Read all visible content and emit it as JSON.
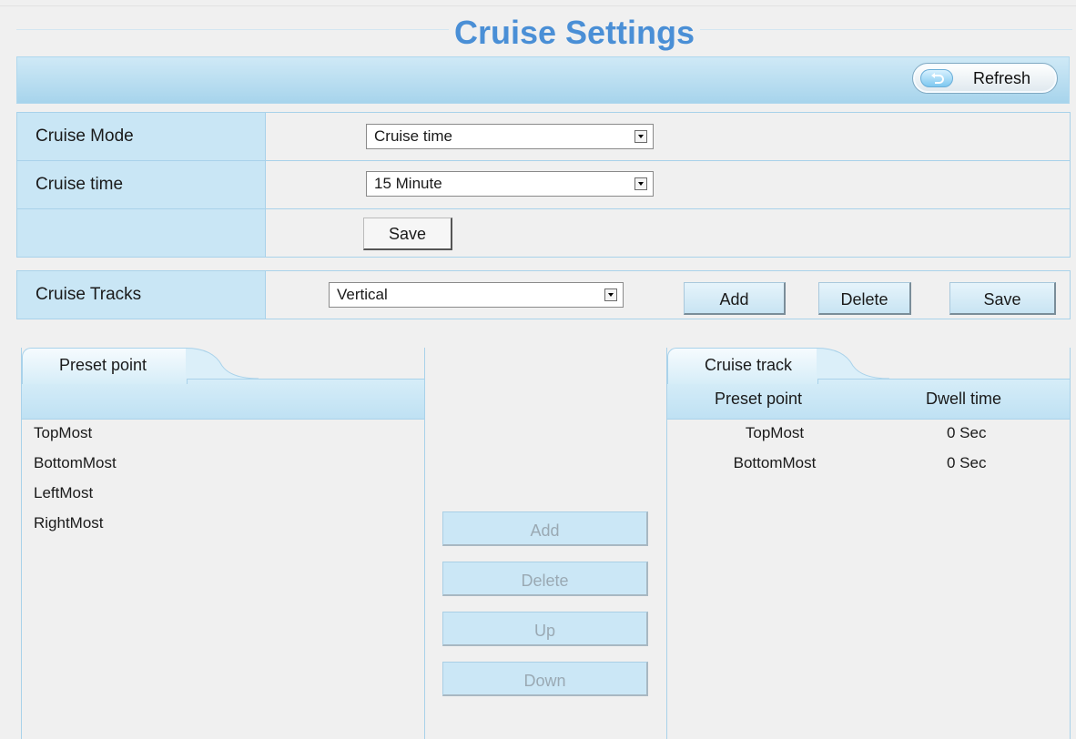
{
  "title": "Cruise Settings",
  "header": {
    "refresh_label": "Refresh"
  },
  "cruise_form": {
    "mode_label": "Cruise Mode",
    "mode_value": "Cruise time",
    "time_label": "Cruise time",
    "time_value": "15 Minute",
    "save_label": "Save"
  },
  "tracks_form": {
    "label": "Cruise Tracks",
    "value": "Vertical",
    "add_label": "Add",
    "delete_label": "Delete",
    "save_label": "Save"
  },
  "preset_panel": {
    "tab_label": "Preset point",
    "items": [
      "TopMost",
      "BottomMost",
      "LeftMost",
      "RightMost"
    ]
  },
  "middle_buttons": {
    "add": "Add",
    "delete": "Delete",
    "up": "Up",
    "down": "Down"
  },
  "track_panel": {
    "tab_label": "Cruise track",
    "col_preset": "Preset point",
    "col_dwell": "Dwell time",
    "rows": [
      {
        "preset": "TopMost",
        "dwell": "0 Sec"
      },
      {
        "preset": "BottomMost",
        "dwell": "0 Sec"
      }
    ]
  },
  "colors": {
    "title": "#4a8fd6",
    "label_bg": "#c9e6f5",
    "header_bar": "#a7d4ec"
  },
  "icons": {
    "refresh": "refresh-icon",
    "dropdown": "chevron-down-icon"
  }
}
